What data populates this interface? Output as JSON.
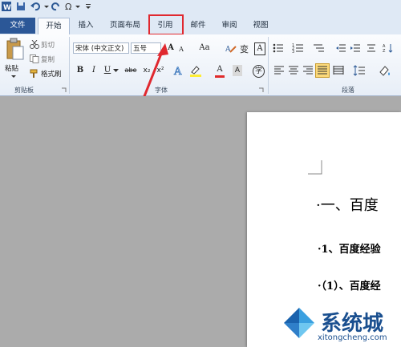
{
  "tabs": {
    "file": "文件",
    "home": "开始",
    "insert": "插入",
    "page_layout": "页面布局",
    "references": "引用",
    "mailings": "邮件",
    "review": "审阅",
    "view": "视图"
  },
  "clipboard": {
    "paste": "粘贴",
    "cut": "剪切",
    "copy": "复制",
    "format_painter": "格式刷",
    "group_label": "剪贴板"
  },
  "font": {
    "font_name": "宋体 (中文正文)",
    "font_size": "五号",
    "group_label": "字体",
    "bold": "B",
    "italic": "I",
    "underline": "U",
    "strikethrough": "abe",
    "subscript": "x₂",
    "superscript": "x²",
    "grow": "A",
    "shrink": "A",
    "case": "Aa",
    "font_color": "A",
    "char_border": "A",
    "enclose": "字"
  },
  "paragraph": {
    "group_label": "段落"
  },
  "document": {
    "line1": "·一、百度",
    "line2": "·1、百度经验",
    "line3": "·（1）、百度经"
  },
  "watermark": {
    "brand": "系统城",
    "url": "xitongcheng.com"
  },
  "colors": {
    "accent_file_tab": "#2b5797",
    "highlight": "#e0282f",
    "ribbon_bg": "#dfe9f5"
  }
}
